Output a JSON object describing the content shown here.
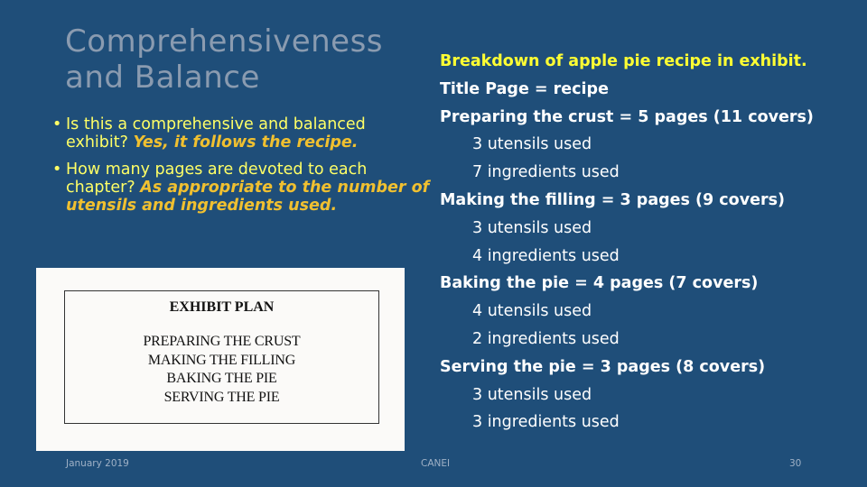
{
  "slide": {
    "title": "Comprehensiveness and Balance",
    "bullets": [
      {
        "question": "Is this a comprehensive and balanced exhibit? ",
        "answer": "Yes, it follows the recipe."
      },
      {
        "question": "How many pages are devoted to each chapter? ",
        "answer": "As appropriate to the number of utensils and ingredients used."
      }
    ],
    "exhibit_plan": {
      "title": "EXHIBIT PLAN",
      "items": [
        "PREPARING THE CRUST",
        "MAKING THE FILLING",
        "BAKING THE PIE",
        "SERVING THE PIE"
      ]
    },
    "breakdown": {
      "heading": "Breakdown of apple pie recipe in exhibit.",
      "title_page": "Title Page = recipe",
      "sections": [
        {
          "label": "Preparing the crust = 5 pages (11 covers)",
          "utensils": "3 utensils used",
          "ingredients": "7 ingredients used"
        },
        {
          "label": "Making the filling = 3 pages (9 covers)",
          "utensils": "3 utensils used",
          "ingredients": "4 ingredients used"
        },
        {
          "label": "Baking the pie = 4 pages (7 covers)",
          "utensils": "4 utensils used",
          "ingredients": "2 ingredients used"
        },
        {
          "label": "Serving the pie = 3 pages (8 covers)",
          "utensils": "3 utensils used",
          "ingredients": "3 ingredients used"
        }
      ]
    },
    "footer": {
      "date": "January 2019",
      "center": "CANEI",
      "page_number": "30"
    }
  },
  "colors": {
    "background": "#1f4e79",
    "title": "#8a9bb0",
    "question_text": "#ffff66",
    "answer_text": "#f0c030",
    "heading": "#ffff33",
    "body_text": "#ffffff"
  }
}
